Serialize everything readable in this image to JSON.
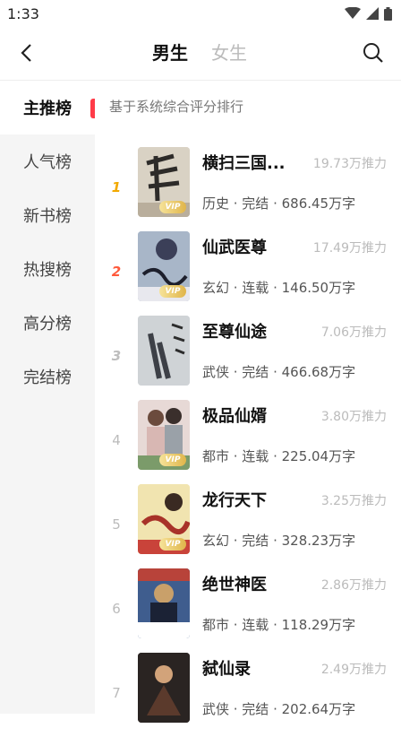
{
  "status": {
    "time": "1:33"
  },
  "header": {
    "tabs": [
      {
        "label": "男生"
      },
      {
        "label": "女生"
      }
    ]
  },
  "sidebar": {
    "items": [
      {
        "label": "主推榜"
      },
      {
        "label": "人气榜"
      },
      {
        "label": "新书榜"
      },
      {
        "label": "热搜榜"
      },
      {
        "label": "高分榜"
      },
      {
        "label": "完结榜"
      }
    ]
  },
  "main": {
    "subtitle": "基于系统综合评分排行",
    "books": [
      {
        "rank": "1",
        "title": "横扫三国...",
        "heat": "19.73万推力",
        "meta": "历史 · 完结 · 686.45万字",
        "cover_color": "#d9d2c4",
        "cover_accent": "#2d2b29"
      },
      {
        "rank": "2",
        "title": "仙武医尊",
        "heat": "17.49万推力",
        "meta": "玄幻 · 连载 · 146.50万字",
        "cover_color": "#a8b6c8",
        "cover_accent": "#3b3f58"
      },
      {
        "rank": "3",
        "title": "至尊仙途",
        "heat": "7.06万推力",
        "meta": "武侠 · 完结 · 466.68万字",
        "cover_color": "#cfd3d6",
        "cover_accent": "#3d4047"
      },
      {
        "rank": "4",
        "title": "极品仙婿",
        "heat": "3.80万推力",
        "meta": "都市 · 连载 · 225.04万字",
        "cover_color": "#e7d9d6",
        "cover_accent": "#7b9b6a"
      },
      {
        "rank": "5",
        "title": "龙行天下",
        "heat": "3.25万推力",
        "meta": "玄幻 · 完结 · 328.23万字",
        "cover_color": "#f1e4b0",
        "cover_accent": "#a83229"
      },
      {
        "rank": "6",
        "title": "绝世神医",
        "heat": "2.86万推力",
        "meta": "都市 · 连载 · 118.29万字",
        "cover_color": "#3f5d8e",
        "cover_accent": "#c9a06a"
      },
      {
        "rank": "7",
        "title": "弑仙录",
        "heat": "2.49万推力",
        "meta": "武侠 · 完结 · 202.64万字",
        "cover_color": "#2a2422",
        "cover_accent": "#d2a37a"
      }
    ],
    "vip_label": "VIP"
  }
}
